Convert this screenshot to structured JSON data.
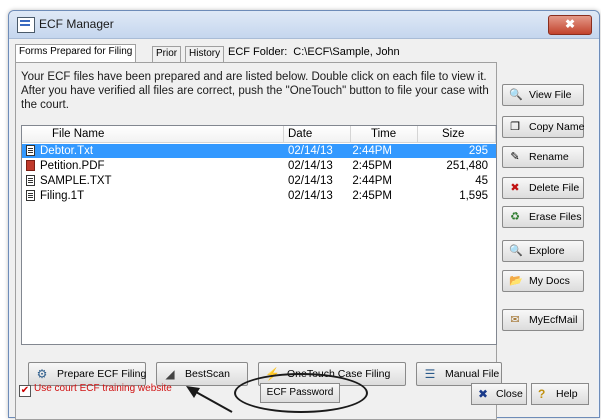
{
  "window": {
    "title": "ECF Manager",
    "close_glyph": "✖"
  },
  "tabs": [
    "Forms Prepared for Filing",
    "Prior",
    "History"
  ],
  "folder": {
    "label": "ECF Folder:",
    "value": "C:\\ECF\\Sample, John"
  },
  "description": "Your ECF files have been prepared and are listed below. Double click on each file to view it. After you have verified all files are correct, push the \"OneTouch\" button to file your case with the court.",
  "list": {
    "columns": [
      "File Name",
      "Date",
      "Time",
      "Size"
    ],
    "rows": [
      {
        "name": "Debtor.Txt",
        "date": "02/14/13",
        "time": "2:44PM",
        "size": "295",
        "icon": "text-file-icon"
      },
      {
        "name": "Petition.PDF",
        "date": "02/14/13",
        "time": "2:45PM",
        "size": "251,480",
        "icon": "pdf-file-icon"
      },
      {
        "name": "SAMPLE.TXT",
        "date": "02/14/13",
        "time": "2:44PM",
        "size": "45",
        "icon": "text-file-icon"
      },
      {
        "name": "Filing.1T",
        "date": "02/14/13",
        "time": "2:45PM",
        "size": "1,595",
        "icon": "text-file-icon"
      }
    ]
  },
  "side_buttons": [
    {
      "label": "View File",
      "icon": "view-icon",
      "glyph": "🔍"
    },
    {
      "label": "Copy Name",
      "icon": "copy-icon",
      "glyph": "❐"
    },
    {
      "label": "Rename",
      "icon": "rename-icon",
      "glyph": "✎"
    },
    {
      "label": "Delete File",
      "icon": "delete-icon",
      "glyph": "✖"
    },
    {
      "label": "Erase Files",
      "icon": "erase-icon",
      "glyph": "♻"
    },
    {
      "label": "Explore",
      "icon": "explore-icon",
      "glyph": "🔍"
    },
    {
      "label": "My Docs",
      "icon": "folder-icon",
      "glyph": "📂"
    },
    {
      "label": "MyEcfMail",
      "icon": "mail-icon",
      "glyph": "✉"
    }
  ],
  "bottom_buttons": [
    {
      "label": "Prepare ECF Filing",
      "icon": "prepare-icon",
      "glyph": "⚙"
    },
    {
      "label": "BestScan",
      "icon": "scan-icon",
      "glyph": "◢"
    },
    {
      "label": "OneTouch Case Filing",
      "icon": "lightning-icon",
      "glyph": "⚡"
    },
    {
      "label": "Manual File",
      "icon": "manual-icon",
      "glyph": "☰"
    }
  ],
  "training": {
    "checked_glyph": "✔",
    "label": "Use court ECF training website"
  },
  "password_label": "ECF Password",
  "close_label": "Close",
  "close_glyph": "✖",
  "help_label": "Help",
  "help_glyph": "?",
  "colors": {
    "selection": "#3399ff",
    "training_text": "#d01010"
  }
}
